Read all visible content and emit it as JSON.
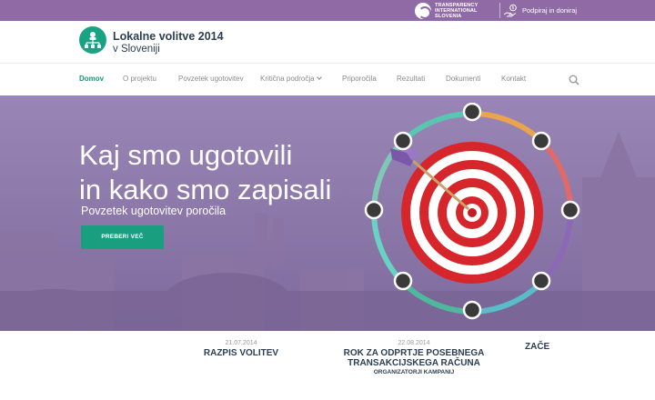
{
  "topbar": {
    "ti_logo_text": [
      "TRANSPARENCY",
      "INTERNATIONAL",
      "SLOVENIA"
    ],
    "donate_label": "Podpiraj in doniraj",
    "color": "#8f6aa5"
  },
  "header": {
    "title": "Lokalne volitve 2014",
    "subtitle": "v Sloveniji",
    "logo_color": "#1aa383"
  },
  "nav": {
    "items": [
      {
        "label": "Domov",
        "active": true
      },
      {
        "label": "O projektu"
      },
      {
        "label": "Povzetek ugotovitev"
      },
      {
        "label": "Kritična področja",
        "dropdown": true
      },
      {
        "label": "Priporočila"
      },
      {
        "label": "Rezultati"
      },
      {
        "label": "Dokumenti"
      },
      {
        "label": "Kontakt"
      }
    ]
  },
  "hero": {
    "title": "Kaj smo ugotovili\nin kako smo zapisali",
    "subtitle": "Povzetek ugotovitev poročila",
    "button_label": "PREBERI VEČ",
    "accent": "#1a9e80"
  },
  "news": [
    {
      "date": "21.07.2014",
      "title": "RAZPIS VOLITEV",
      "org": ""
    },
    {
      "date": "22.08.2014",
      "title": "ROK ZA ODPRTJE POSEBNEGA\nTRANSAKCIJSKEGA RAČUNA",
      "org": "ORGANIZATORJI KAMPANIJ"
    },
    {
      "date": "",
      "title": "ZAČE",
      "org": ""
    }
  ]
}
